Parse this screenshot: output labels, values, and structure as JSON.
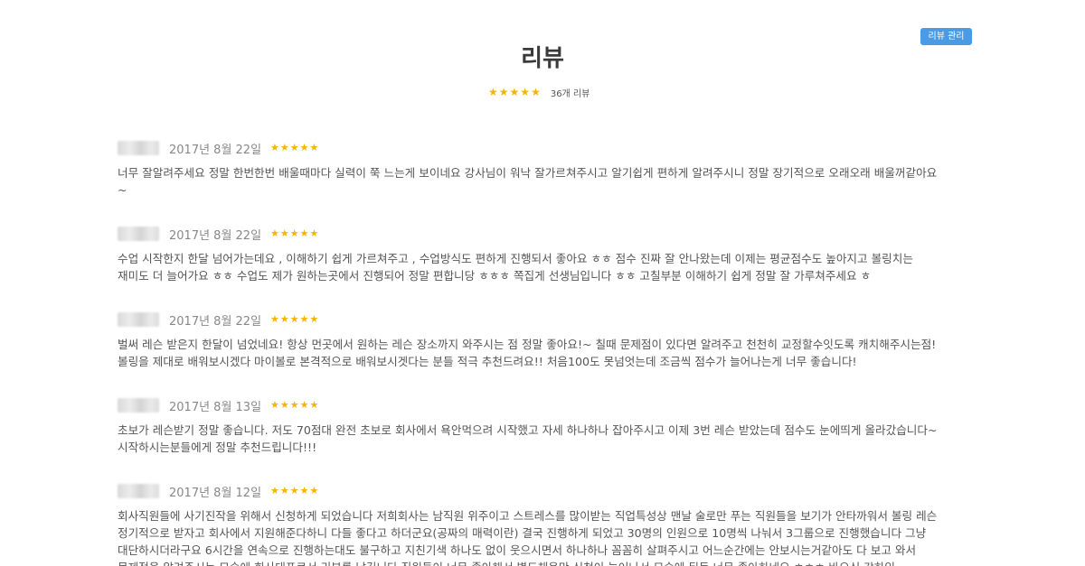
{
  "header": {
    "title": "리뷰",
    "manage_label": "리뷰 관리",
    "review_count": "36개 리뷰",
    "rating_stars": 5
  },
  "reviews": [
    {
      "date": "2017년 8월 22일",
      "stars": 5,
      "text": "너무 잘알려주세요 정말 한번한번 배울때마다 실력이 쭉 느는게 보이네요 강사님이 워낙 잘가르쳐주시고 알기쉽게 편하게 알려주시니 정말 장기적으로 오래오래 배울꺼같아요\n~"
    },
    {
      "date": "2017년 8월 22일",
      "stars": 5,
      "text": "수업 시작한지 한달 넘어가는데요 , 이해하기 쉽게 가르쳐주고 , 수업방식도 편하게 진행되서 좋아요 ㅎㅎ 점수 진짜 잘 안나왔는데 이제는 평균점수도 높아지고 볼링치는\n재미도 더 늘어가요 ㅎㅎ 수업도 제가 원하는곳에서 진행되어 정말 편합니당 ㅎㅎㅎ 쪽집게 선생님입니다 ㅎㅎ 고칠부분 이해하기 쉽게 정말 잘 가루쳐주세요 ㅎ"
    },
    {
      "date": "2017년 8월 22일",
      "stars": 5,
      "text": "벌써 레슨 받은지 한달이 넘었네요! 항상 먼곳에서 원하는 레슨 장소까지 와주시는 점 정말 좋아요!~ 칠때 문제점이 있다면 알려주고 천천히 교정할수잇도록 캐치해주시는점!\n볼링을 제대로 배워보시겠다 마이볼로 본격적으로 배워보시겟다는 분들 적극 추천드려요!! 처음100도 못넘엇는데 조금씩 점수가 늘어나는게 너무 좋습니다!"
    },
    {
      "date": "2017년 8월 13일",
      "stars": 5,
      "text": "초보가 레슨받기 정말 좋습니다. 저도 70점대 완전 초보로 회사에서 욕안먹으려 시작했고 자세 하나하나 잡아주시고 이제 3번 레슨 받았는데 점수도 눈에띄게 올라갔습니다~\n시작하시는분들에게 정말 추천드립니다!!!"
    },
    {
      "date": "2017년 8월 12일",
      "stars": 5,
      "text": "회사직원들에 사기진작을 위해서 신청하게 되었습니다 저희회사는 남직원 위주이고 스트레스를 많이받는 직업특성상 맨날 술로만 푸는 직원들을 보기가 안타까워서 볼링 레슨\n정기적으로 받자고 회사에서 지원해준다하니 다들 좋다고 하더군요(공짜의 매력이란) 결국 진행하게 되었고 30명의 인원으로 10명씩 나눠서 3그룹으로 진행했습니다 그냥\n대단하시더라구요 6시간을 연속으로 진행하는대도 불구하고 지친기색 하나도 없이 웃으시면서 하나하나 꼼꼼히 살펴주시고 어느순간에는 안보시는거같아도 다 보고 와서\n문제점을 알려주시는 모습에 회사대표로서 리뷰를 남깁니다 직원들이 너무 좋아해서 별도채용만 신청이 늘어나서 모습에 뒤듣 너무 좋아하네요 ㅎㅎㅎ 바으신 강하임"
    }
  ]
}
